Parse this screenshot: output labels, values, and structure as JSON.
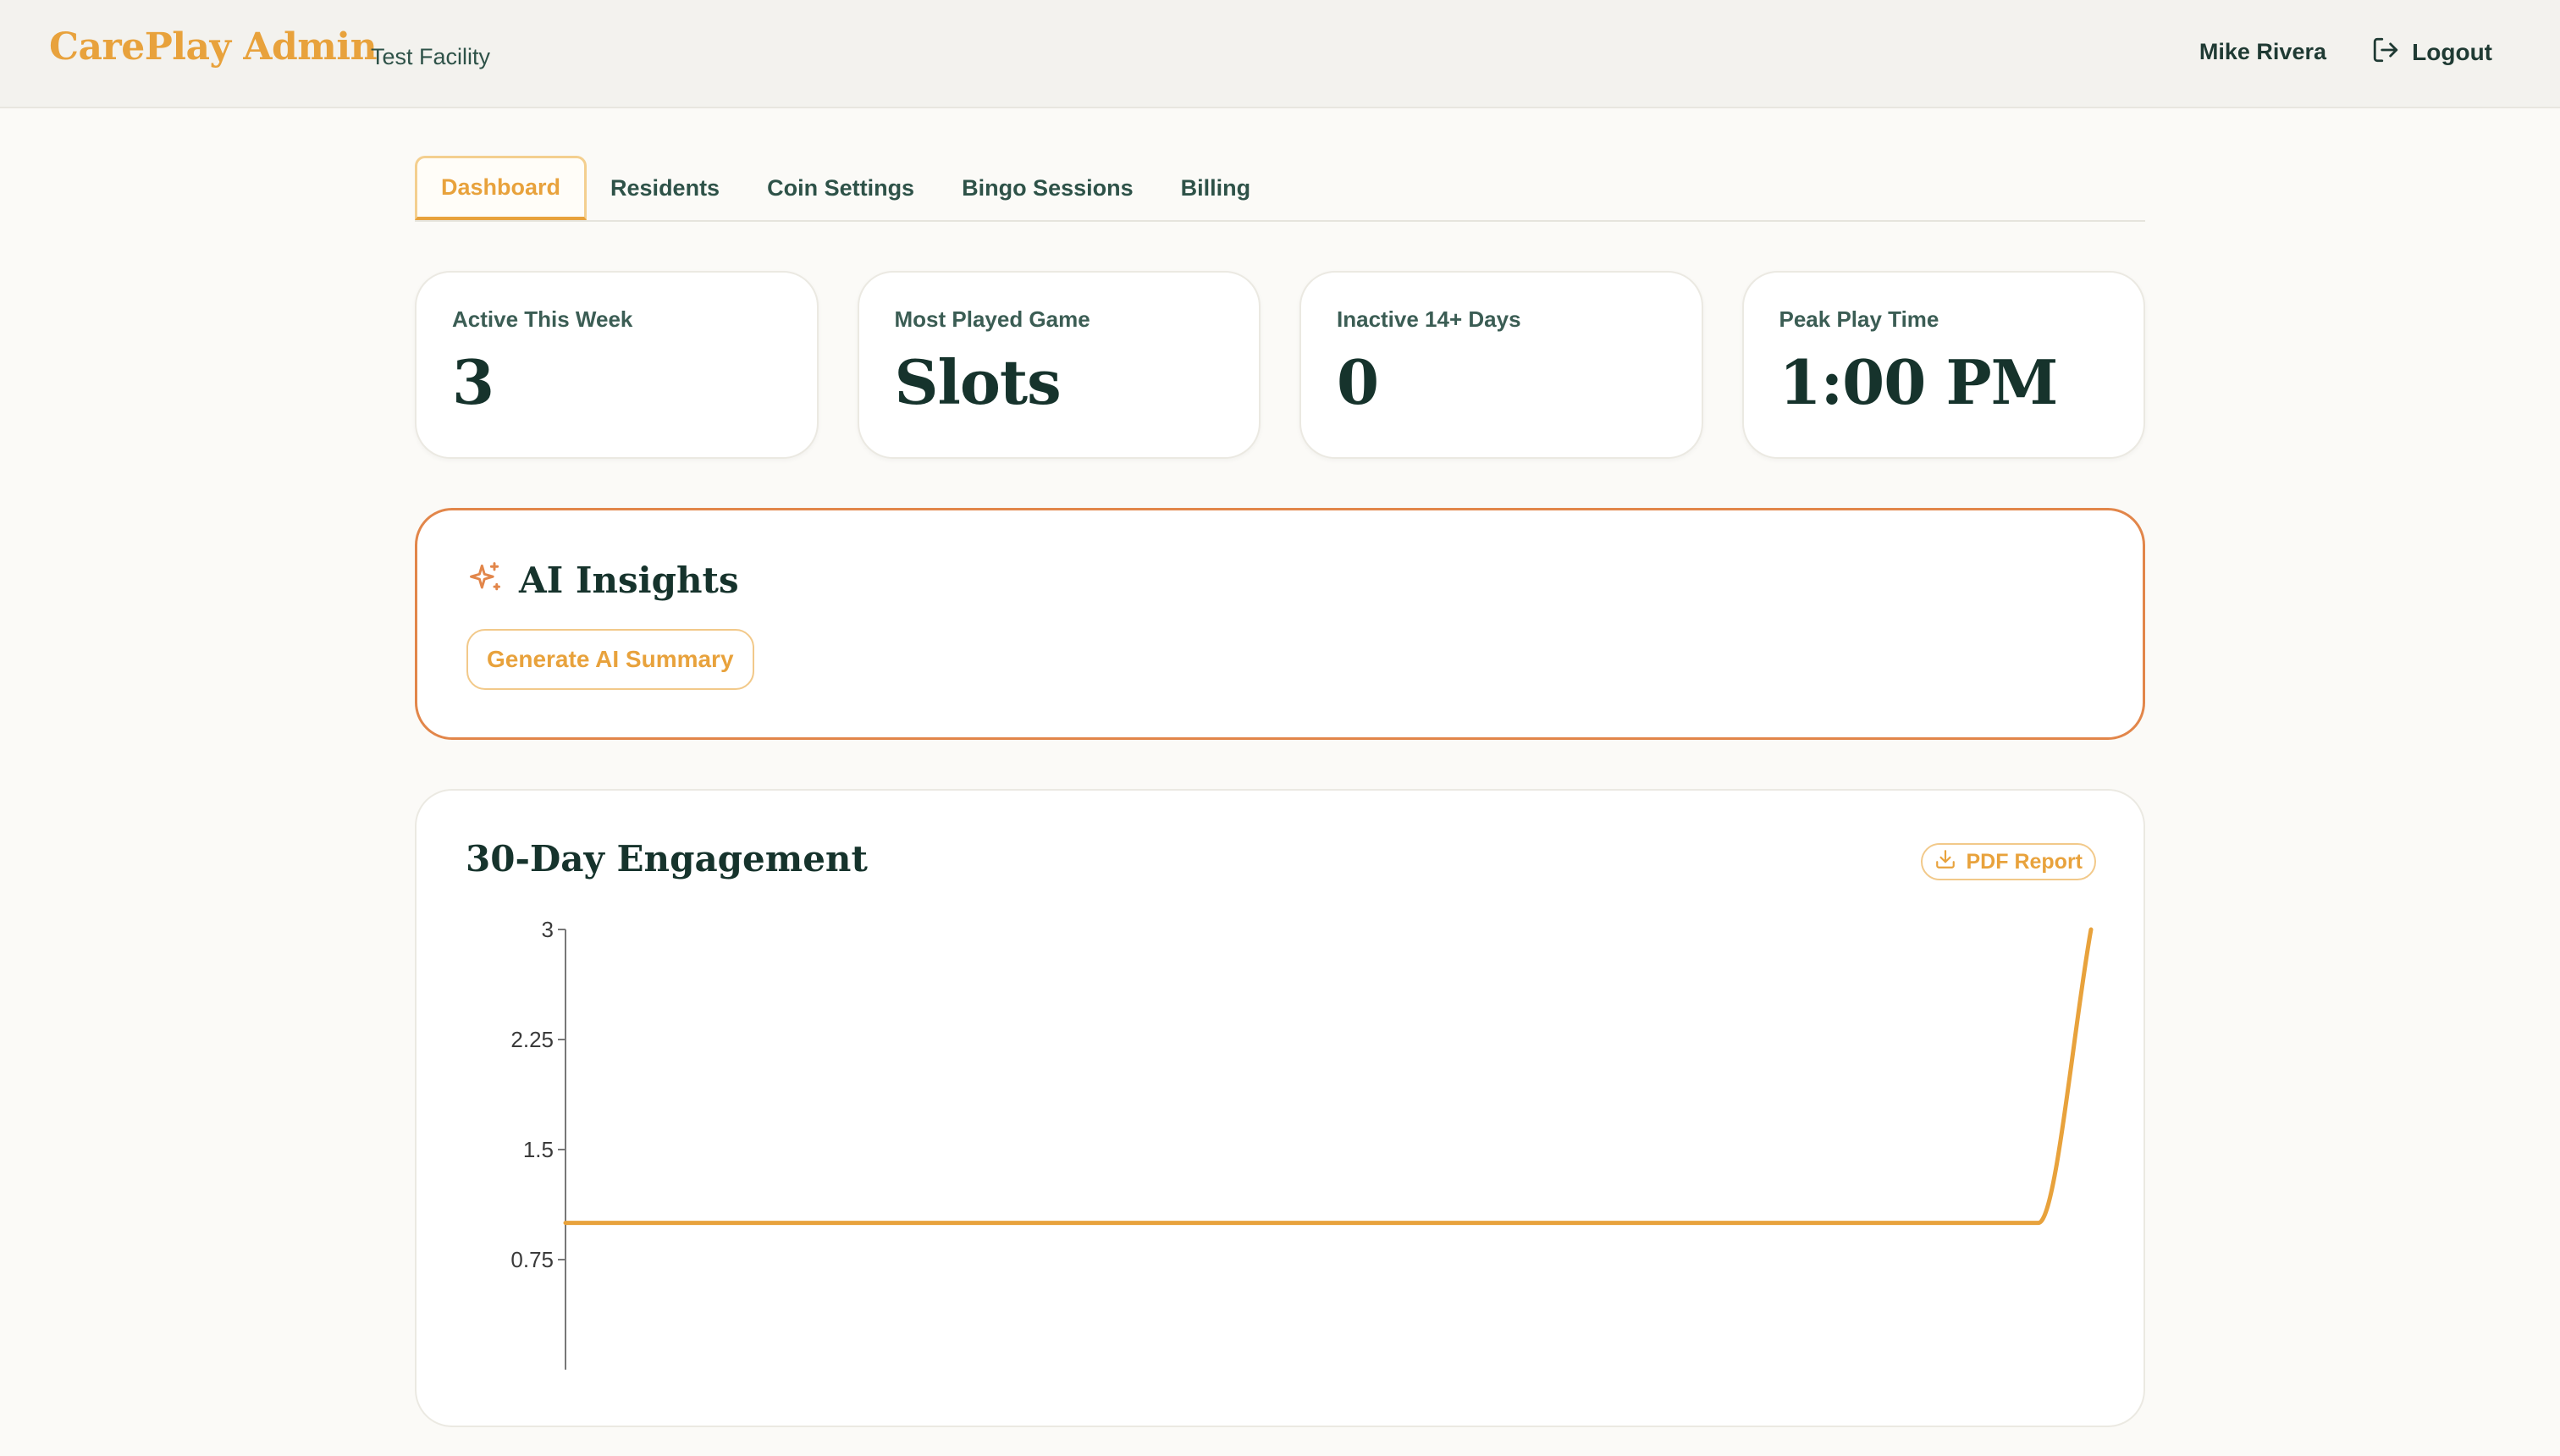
{
  "app": {
    "brand": "CarePlay Admin",
    "facility": "Test Facility"
  },
  "user": {
    "name": "Mike Rivera",
    "logout_label": "Logout"
  },
  "tabs": [
    {
      "label": "Dashboard",
      "active": true
    },
    {
      "label": "Residents",
      "active": false
    },
    {
      "label": "Coin Settings",
      "active": false
    },
    {
      "label": "Bingo Sessions",
      "active": false
    },
    {
      "label": "Billing",
      "active": false
    }
  ],
  "stats": [
    {
      "label": "Active This Week",
      "value": "3"
    },
    {
      "label": "Most Played Game",
      "value": "Slots"
    },
    {
      "label": "Inactive 14+ Days",
      "value": "0"
    },
    {
      "label": "Peak Play Time",
      "value": "1:00 PM"
    }
  ],
  "ai_insights": {
    "title": "AI Insights",
    "icon": "sparkle-icon",
    "button_label": "Generate AI Summary"
  },
  "engagement": {
    "title": "30-Day Engagement",
    "pdf_label": "PDF Report",
    "pdf_icon": "download-icon"
  },
  "colors": {
    "accent": "#e8a23c",
    "ai_border": "#e2864a",
    "text_dark": "#16332c"
  },
  "chart_data": {
    "type": "line",
    "title": "30-Day Engagement",
    "xlabel": "",
    "ylabel": "",
    "ylim": [
      0,
      3
    ],
    "y_ticks": [
      0.75,
      1.5,
      2.25,
      3
    ],
    "x": [
      1,
      2,
      3,
      4,
      5,
      6,
      7,
      8,
      9,
      10,
      11,
      12,
      13,
      14,
      15,
      16,
      17,
      18,
      19,
      20,
      21,
      22,
      23,
      24,
      25,
      26,
      27,
      28,
      29,
      30
    ],
    "series": [
      {
        "values": [
          1,
          1,
          1,
          1,
          1,
          1,
          1,
          1,
          1,
          1,
          1,
          1,
          1,
          1,
          1,
          1,
          1,
          1,
          1,
          1,
          1,
          1,
          1,
          1,
          1,
          1,
          1,
          1,
          1,
          3
        ],
        "color": "#e8a23c"
      }
    ],
    "grid": false,
    "curve": "smooth"
  }
}
